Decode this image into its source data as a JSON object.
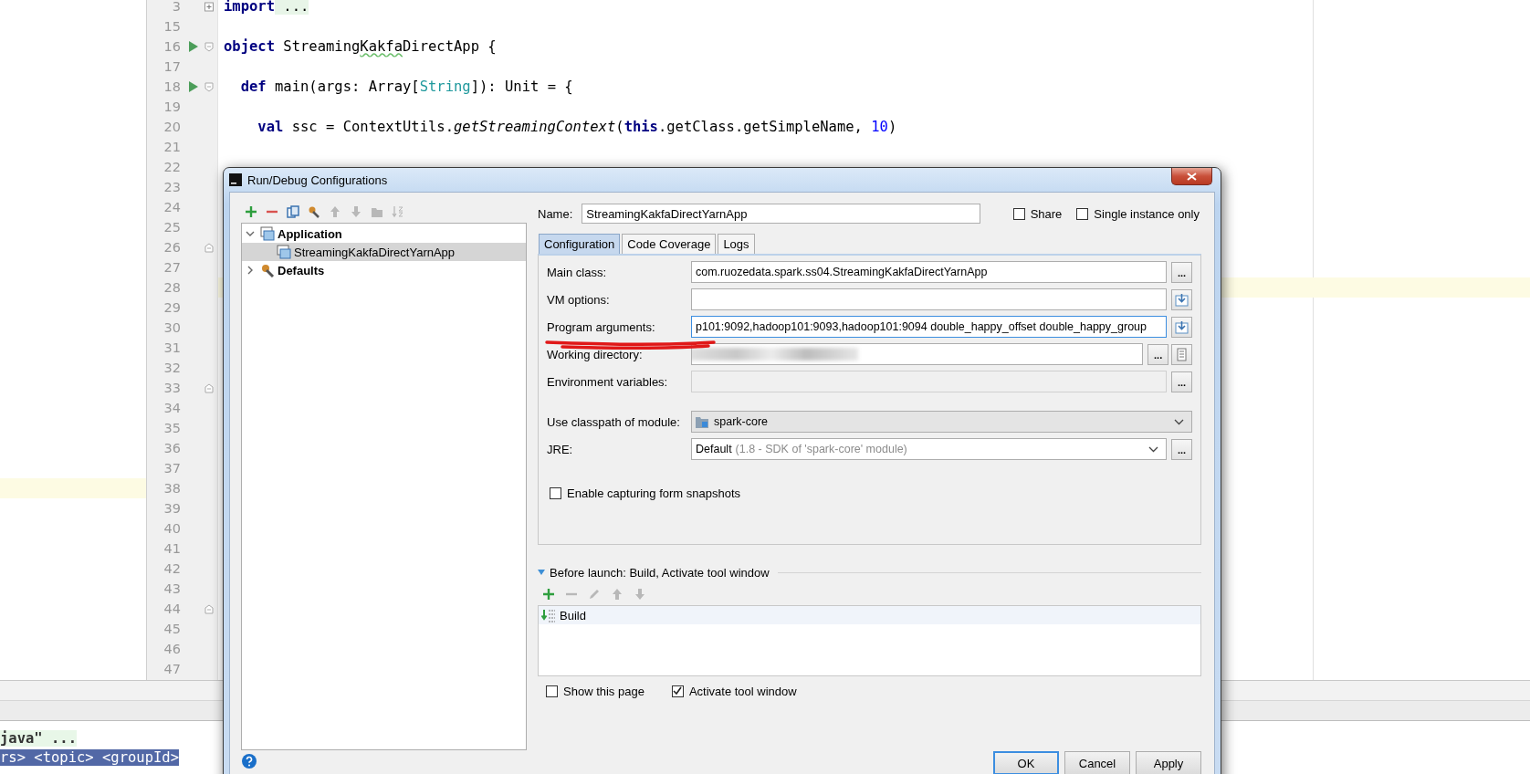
{
  "editor": {
    "lines": [
      {
        "number": "3",
        "kind": "collapsed",
        "current": false,
        "marked": false,
        "run": false,
        "tokens": [
          {
            "kind": "kw",
            "text": "import"
          },
          {
            "kind": "folded",
            "text": " ..."
          }
        ]
      },
      {
        "number": "15",
        "kind": "plain",
        "current": false,
        "marked": false,
        "run": false
      },
      {
        "number": "16",
        "kind": "fold-start",
        "current": false,
        "marked": false,
        "run": true,
        "tokens": [
          {
            "kind": "kw",
            "text": "object"
          },
          {
            "kind": "plain",
            "text": " Streaming"
          },
          {
            "kind": "typo",
            "text": "Kakfa"
          },
          {
            "kind": "plain",
            "text": "DirectApp {"
          }
        ]
      },
      {
        "number": "17",
        "kind": "plain",
        "current": false,
        "marked": false,
        "run": false
      },
      {
        "number": "18",
        "kind": "fold-start",
        "current": false,
        "marked": false,
        "run": true,
        "tokens": [
          {
            "kind": "kw",
            "text": "  def"
          },
          {
            "kind": "plain",
            "text": " main(args: Array["
          },
          {
            "kind": "type",
            "text": "String"
          },
          {
            "kind": "plain",
            "text": "]): Unit = {"
          }
        ]
      },
      {
        "number": "19",
        "kind": "plain",
        "current": false,
        "marked": false,
        "run": false
      },
      {
        "number": "20",
        "kind": "plain",
        "current": false,
        "marked": false,
        "run": false,
        "tokens": [
          {
            "kind": "kw",
            "text": "    val"
          },
          {
            "kind": "plain",
            "text": " ssc = ContextUtils."
          },
          {
            "kind": "italic",
            "text": "getStreamingContext"
          },
          {
            "kind": "plain",
            "text": "("
          },
          {
            "kind": "kw",
            "text": "this"
          },
          {
            "kind": "plain",
            "text": ".getClass.getSimpleName, "
          },
          {
            "kind": "num",
            "text": "10"
          },
          {
            "kind": "plain",
            "text": ")"
          }
        ]
      },
      {
        "number": "21",
        "kind": "plain",
        "current": false,
        "marked": false,
        "run": false
      },
      {
        "number": "22",
        "kind": "plain",
        "current": false,
        "marked": false,
        "run": false
      },
      {
        "number": "23",
        "kind": "plain",
        "current": false,
        "marked": false,
        "run": false
      },
      {
        "number": "24",
        "kind": "plain",
        "current": false,
        "marked": false,
        "run": false
      },
      {
        "number": "25",
        "kind": "plain",
        "current": false,
        "marked": false,
        "run": false
      },
      {
        "number": "26",
        "kind": "fold-end",
        "current": false,
        "marked": false,
        "run": false
      },
      {
        "number": "27",
        "kind": "plain",
        "current": false,
        "marked": false,
        "run": false
      },
      {
        "number": "28",
        "kind": "plain",
        "current": true,
        "marked": false,
        "run": false
      },
      {
        "number": "29",
        "kind": "plain",
        "current": false,
        "marked": false,
        "run": false
      },
      {
        "number": "30",
        "kind": "plain",
        "current": false,
        "marked": false,
        "run": false
      },
      {
        "number": "31",
        "kind": "plain",
        "current": false,
        "marked": false,
        "run": false
      },
      {
        "number": "32",
        "kind": "plain",
        "current": false,
        "marked": false,
        "run": false
      },
      {
        "number": "33",
        "kind": "fold-end",
        "current": false,
        "marked": false,
        "run": false
      },
      {
        "number": "34",
        "kind": "plain",
        "current": false,
        "marked": false,
        "run": false
      },
      {
        "number": "35",
        "kind": "plain",
        "current": false,
        "marked": false,
        "run": false
      },
      {
        "number": "36",
        "kind": "plain",
        "current": false,
        "marked": false,
        "run": false
      },
      {
        "number": "37",
        "kind": "plain",
        "current": false,
        "marked": false,
        "run": false
      },
      {
        "number": "38",
        "kind": "plain",
        "current": false,
        "marked": true,
        "run": false
      },
      {
        "number": "39",
        "kind": "plain",
        "current": false,
        "marked": false,
        "run": false
      },
      {
        "number": "40",
        "kind": "plain",
        "current": false,
        "marked": false,
        "run": false
      },
      {
        "number": "41",
        "kind": "plain",
        "current": false,
        "marked": false,
        "run": false
      },
      {
        "number": "42",
        "kind": "plain",
        "current": false,
        "marked": false,
        "run": false
      },
      {
        "number": "43",
        "kind": "plain",
        "current": false,
        "marked": false,
        "run": false
      },
      {
        "number": "44",
        "kind": "fold-end",
        "current": false,
        "marked": false,
        "run": false
      },
      {
        "number": "45",
        "kind": "plain",
        "current": false,
        "marked": false,
        "run": false
      },
      {
        "number": "46",
        "kind": "plain",
        "current": false,
        "marked": false,
        "run": false
      },
      {
        "number": "47",
        "kind": "plain",
        "current": false,
        "marked": false,
        "run": false
      }
    ]
  },
  "console": {
    "lines": [
      {
        "kind": "folded",
        "text": "java\" ...",
        "selected": false
      },
      {
        "kind": "plain",
        "text": "rs> <topic> <groupId>",
        "selected": true
      }
    ]
  },
  "dialog": {
    "title": "Run/Debug Configurations",
    "toolbar": [
      {
        "kind": "add",
        "disabled": false
      },
      {
        "kind": "remove",
        "disabled": false
      },
      {
        "kind": "copy",
        "disabled": false
      },
      {
        "kind": "wrench",
        "disabled": false
      },
      {
        "kind": "up",
        "disabled": true
      },
      {
        "kind": "down",
        "disabled": true
      },
      {
        "kind": "folder",
        "disabled": true
      },
      {
        "kind": "sort",
        "disabled": true
      }
    ],
    "tree": [
      {
        "label": "Application",
        "kind": "group",
        "expanded": true,
        "selected": false,
        "children": [
          {
            "label": "StreamingKakfaDirectYarnApp",
            "kind": "config",
            "selected": true
          }
        ]
      },
      {
        "label": "Defaults",
        "kind": "defaults",
        "expanded": false,
        "selected": false
      }
    ],
    "name": {
      "label": "Name:",
      "value": "StreamingKakfaDirectYarnApp"
    },
    "options": [
      {
        "label": "Share",
        "checked": false
      },
      {
        "label": "Single instance only",
        "checked": false
      }
    ],
    "tabs": [
      {
        "label": "Configuration",
        "selected": true
      },
      {
        "label": "Code Coverage",
        "selected": false
      },
      {
        "label": "Logs",
        "selected": false
      }
    ],
    "fields": [
      {
        "kind": "text",
        "label": "Main class:",
        "value": "com.ruozedata.spark.ss04.StreamingKakfaDirectYarnApp",
        "focused": false,
        "disabled": false,
        "buttons": [
          {
            "kind": "browse",
            "text": "..."
          }
        ]
      },
      {
        "kind": "text",
        "label": "VM options:",
        "focused": false,
        "disabled": false,
        "buttons": [
          {
            "kind": "expand"
          }
        ]
      },
      {
        "kind": "text",
        "label": "Program arguments:",
        "value": "p101:9092,hadoop101:9093,hadoop101:9094 double_happy_offset double_happy_group",
        "focused": true,
        "disabled": false,
        "buttons": [
          {
            "kind": "expand"
          }
        ]
      },
      {
        "kind": "blurred",
        "label": "Working directory:",
        "focused": false,
        "disabled": false,
        "buttons": [
          {
            "kind": "browse",
            "text": "..."
          },
          {
            "kind": "macro"
          }
        ]
      },
      {
        "kind": "text",
        "label": "Environment variables:",
        "focused": false,
        "disabled": true,
        "buttons": [
          {
            "kind": "browse",
            "text": "..."
          }
        ]
      },
      {
        "kind": "module",
        "label": "Use classpath of module:",
        "value": "spark-core"
      },
      {
        "kind": "jre",
        "label": "JRE:",
        "value": "Default",
        "hint": "(1.8 - SDK of 'spark-core' module)",
        "buttons": [
          {
            "kind": "browse",
            "text": "..."
          }
        ]
      }
    ],
    "snapshot": {
      "label": "Enable capturing form snapshots",
      "checked": false
    },
    "before_launch": {
      "title": "Before launch: Build, Activate tool window",
      "expanded": true,
      "toolbar": [
        {
          "kind": "add",
          "disabled": false
        },
        {
          "kind": "remove",
          "disabled": true
        },
        {
          "kind": "edit",
          "disabled": true
        },
        {
          "kind": "up",
          "disabled": true
        },
        {
          "kind": "down",
          "disabled": true
        }
      ],
      "tasks": [
        {
          "label": "Build",
          "selected": true
        }
      ]
    },
    "footer_options": [
      {
        "label": "Show this page",
        "checked": false
      },
      {
        "label": "Activate tool window",
        "checked": true
      }
    ],
    "buttons": [
      {
        "label": "OK",
        "default": true
      },
      {
        "label": "Cancel",
        "default": false
      },
      {
        "label": "Apply",
        "default": false
      }
    ]
  }
}
